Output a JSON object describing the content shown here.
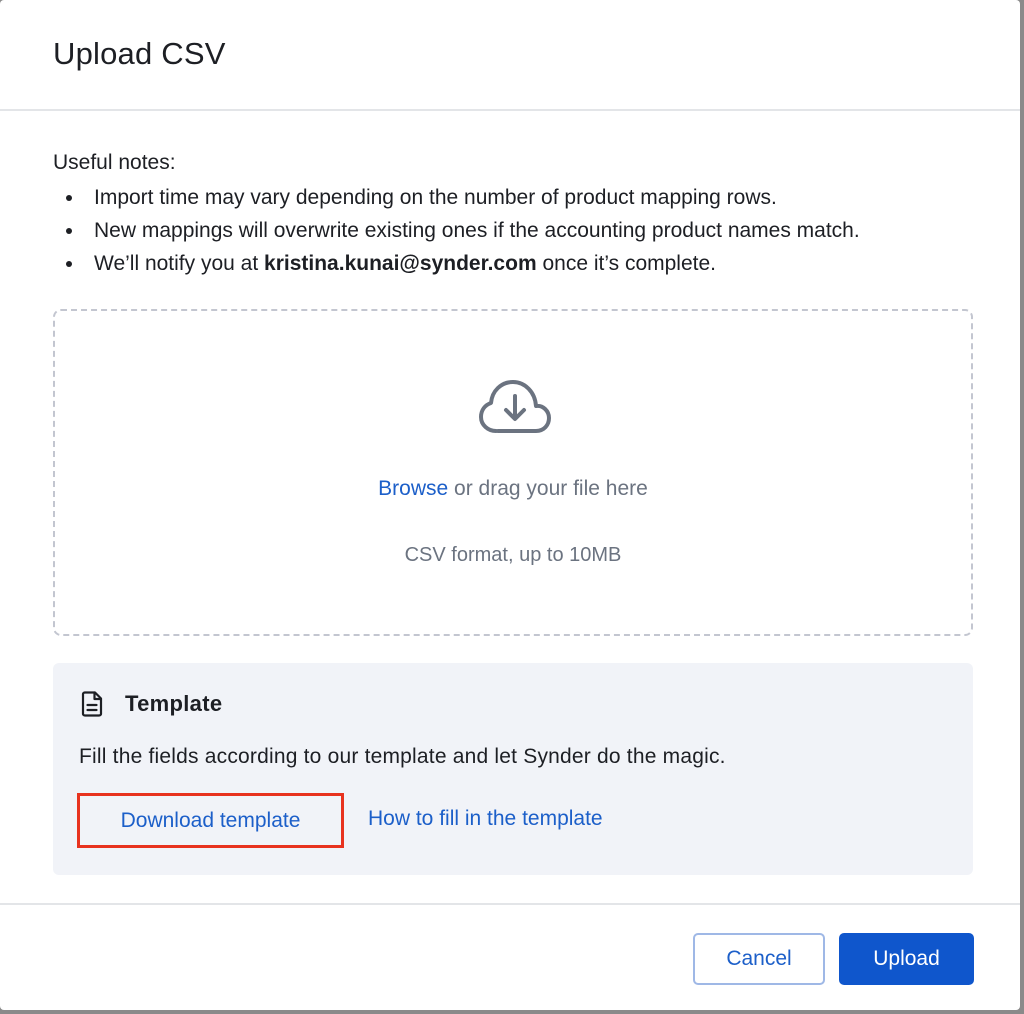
{
  "dialog": {
    "title": "Upload CSV"
  },
  "notes": {
    "heading": "Useful notes:",
    "items": [
      "Import time may vary depending on the number of product mapping rows.",
      "New mappings will overwrite existing ones if the accounting product names match."
    ],
    "notify_prefix": "We’ll notify you at ",
    "notify_email": "kristina.kunai@synder.com",
    "notify_suffix": " once it’s complete."
  },
  "dropzone": {
    "icon": "cloud-download-icon",
    "browse_label": "Browse",
    "drag_text": " or drag your file here",
    "format_text": "CSV format, up to 10MB"
  },
  "template": {
    "icon": "document-icon",
    "title": "Template",
    "description": "Fill the fields according to our template and let Synder do the magic.",
    "download_label": "Download template",
    "howto_label": "How to fill in the template"
  },
  "footer": {
    "cancel_label": "Cancel",
    "upload_label": "Upload"
  },
  "colors": {
    "accent": "#0f56cc",
    "link": "#1c5fc9",
    "highlight_border": "#e8321e",
    "template_bg": "#f1f3f8"
  }
}
